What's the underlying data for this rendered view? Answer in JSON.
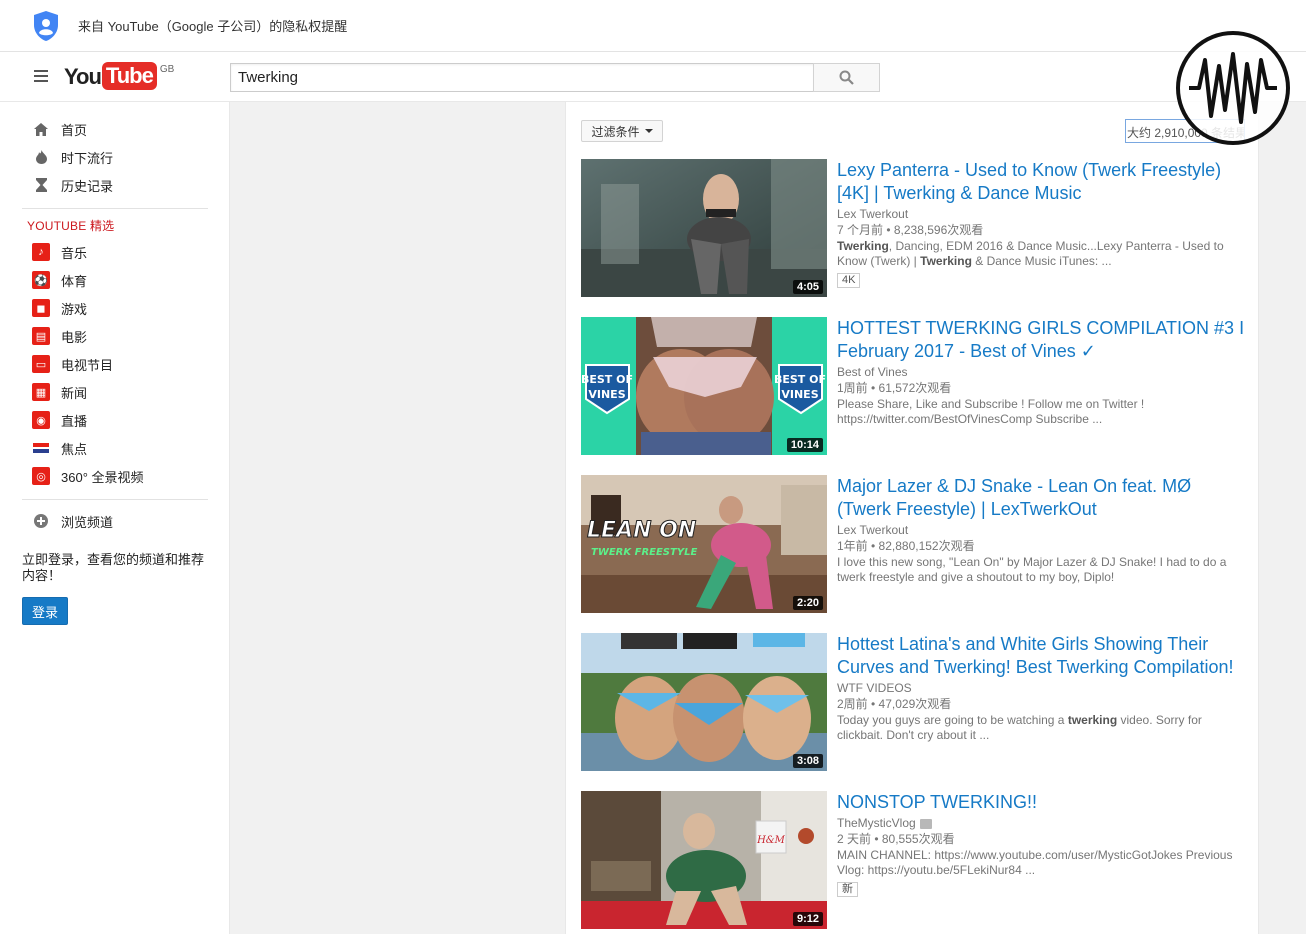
{
  "privacy": {
    "text": "来自 YouTube（Google 子公司）的隐私权提醒"
  },
  "header": {
    "logo_you": "You",
    "logo_tube": "Tube",
    "region": "GB",
    "search_value": "Twerking"
  },
  "sidebar": {
    "main_items": [
      {
        "label": "首页",
        "icon": "home-icon"
      },
      {
        "label": "时下流行",
        "icon": "flame-icon"
      },
      {
        "label": "历史记录",
        "icon": "hourglass-icon"
      }
    ],
    "section_title": "YOUTUBE 精选",
    "featured_items": [
      {
        "label": "音乐",
        "icon": "music-icon"
      },
      {
        "label": "体育",
        "icon": "sports-icon"
      },
      {
        "label": "游戏",
        "icon": "gaming-icon"
      },
      {
        "label": "电影",
        "icon": "film-icon"
      },
      {
        "label": "电视节目",
        "icon": "tv-icon"
      },
      {
        "label": "新闻",
        "icon": "news-icon"
      },
      {
        "label": "直播",
        "icon": "live-icon"
      },
      {
        "label": "焦点",
        "icon": "spotlight-icon"
      },
      {
        "label": "360° 全景视频",
        "icon": "360-icon"
      }
    ],
    "browse_channels": "浏览频道",
    "login_prompt": "立即登录，查看您的频道和推荐内容！",
    "login_button": "登录"
  },
  "results": {
    "filter_label": "过滤条件",
    "count_text": "大约 2,910,000 条结果",
    "videos": [
      {
        "title": "Lexy Panterra - Used to Know (Twerk Freestyle) [4K] | Twerking & Dance Music",
        "channel": "Lex Twerkout",
        "meta": "7 个月前 • 8,238,596次观看",
        "desc_html_1": "Twerking",
        "desc_1": ", Dancing, EDM 2016 & Dance Music...Lexy Panterra - Used to Know (Twerk) | ",
        "desc_html_2": "Twerking",
        "desc_2": " & Dance Music iTunes: ...",
        "badge": "4K",
        "duration": "4:05"
      },
      {
        "title": "HOTTEST TWERKING GIRLS COMPILATION #3 I February 2017 - Best of Vines ✓",
        "channel": "Best of Vines",
        "meta": "1周前 • 61,572次观看",
        "desc": "Please Share, Like and Subscribe ! Follow me on Twitter ! https://twitter.com/BestOfVinesComp Subscribe ...",
        "thumb_text": "BEST OF VINES",
        "duration": "10:14"
      },
      {
        "title": "Major Lazer & DJ Snake - Lean On feat. MØ (Twerk Freestyle) | LexTwerkOut",
        "channel": "Lex Twerkout",
        "meta": "1年前 • 82,880,152次观看",
        "desc": "I love this new song, \"Lean On\" by Major Lazer & DJ Snake! I had to do a twerk freestyle and give a shoutout to my boy, Diplo!",
        "thumb_text_1": "LEAN ON",
        "thumb_text_2": "TWERK FREESTYLE",
        "duration": "2:20"
      },
      {
        "title": "Hottest Latina's and White Girls Showing Their Curves and Twerking! Best Twerking Compilation!",
        "channel": "WTF VIDEOS",
        "meta": "2周前 • 47,029次观看",
        "desc_a": "Today you guys are going to be watching a ",
        "desc_bold": "twerking",
        "desc_b": " video. Sorry for clickbait. Don't cry about it ...",
        "duration": "3:08"
      },
      {
        "title": "NONSTOP TWERKING!!",
        "channel": "TheMysticVlog",
        "meta": "2 天前 • 80,555次观看",
        "desc": "MAIN CHANNEL: https://www.youtube.com/user/MysticGotJokes Previous Vlog: https://youtu.be/5FLekiNur84 ...",
        "badge": "新",
        "thumb_text": "H&M",
        "duration": "9:12"
      }
    ]
  },
  "colors": {
    "accent": "#e62117",
    "link": "#167ac6",
    "signin": "#167ac6"
  }
}
